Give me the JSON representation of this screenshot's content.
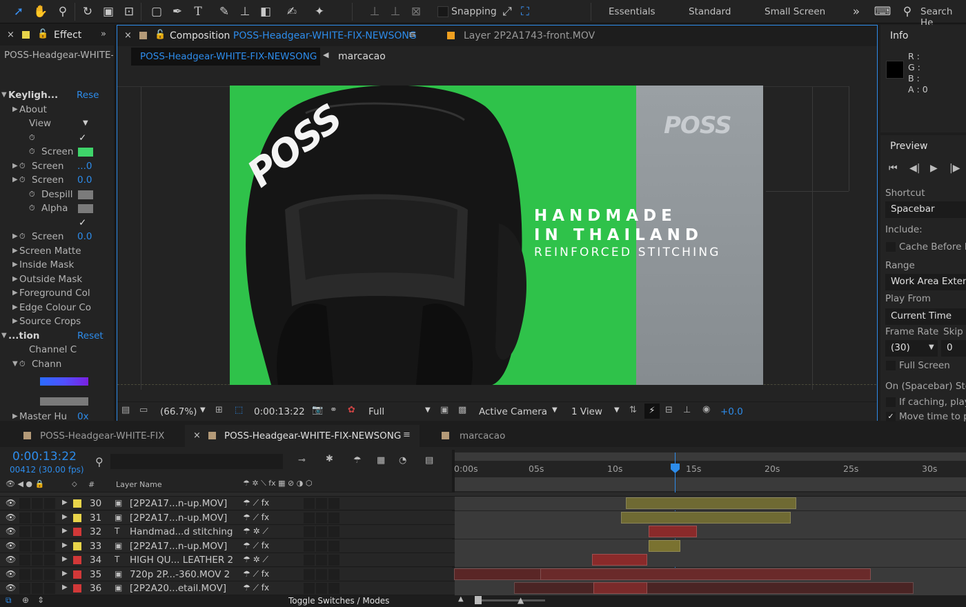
{
  "toolbar": {
    "snapping_label": "Snapping",
    "workspaces": [
      "Essentials",
      "Standard",
      "Small Screen"
    ],
    "search_placeholder": "Search He"
  },
  "effects_panel": {
    "tab_label": "Effect",
    "layer_name": "POSS-Headgear-WHITE-",
    "rows": [
      {
        "label": "Keyligh...",
        "value": "Rese"
      },
      {
        "label": "About"
      },
      {
        "label": "View"
      },
      {
        "label": "",
        "value": "✓"
      },
      {
        "label": "Screen",
        "swatch": "#3fd46a"
      },
      {
        "label": "Screen",
        "value": "...0"
      },
      {
        "label": "Screen",
        "value": "0.0"
      },
      {
        "label": "Despill",
        "swatch": "#7b7b7b"
      },
      {
        "label": "Alpha",
        "swatch": "#7b7b7b"
      },
      {
        "label": "",
        "value": "✓"
      },
      {
        "label": "Screen",
        "value": "0.0"
      },
      {
        "label": "Screen Matte"
      },
      {
        "label": "Inside Mask"
      },
      {
        "label": "Outside Mask"
      },
      {
        "label": "Foreground Col"
      },
      {
        "label": "Edge Colour Co"
      },
      {
        "label": "Source Crops"
      },
      {
        "label": "...tion",
        "value": "Reset"
      },
      {
        "label": "Channel C"
      },
      {
        "label": "Chann"
      },
      {
        "label": "Master Hu",
        "value": "0x"
      }
    ]
  },
  "comp_panel": {
    "tab_label_prefix": "Composition",
    "tab_comp_name": "POSS-Headgear-WHITE-FIX-NEWSONG",
    "tab_layer": "Layer 2P2A1743-front.MOV",
    "breadcrumb_comp": "POSS-Headgear-WHITE-FIX-NEWSONG",
    "breadcrumb_child": "marcacao",
    "video": {
      "headline1": "HANDMADE",
      "headline2": "IN THAILAND",
      "subline": "REINFORCED STITCHING",
      "logo_text": "POSS",
      "helmet_logo": "POSS",
      "green": "#2fc24a",
      "gray": "#8e9498"
    },
    "footer": {
      "zoom": "(66.7%)",
      "timecode": "0:00:13:22",
      "quality": "Full",
      "camera": "Active Camera",
      "views": "1 View",
      "exposure": "+0.0"
    }
  },
  "info_panel": {
    "title": "Info",
    "r": "R :",
    "g": "G :",
    "b": "B :",
    "a": "A : 0"
  },
  "preview_panel": {
    "title": "Preview",
    "shortcut_label": "Shortcut",
    "shortcut_value": "Spacebar",
    "include_label": "Include:",
    "cache_label": "Cache Before P",
    "range_label": "Range",
    "range_value": "Work Area Extend",
    "playfrom_label": "Play From",
    "playfrom_value": "Current Time",
    "framerate_label": "Frame Rate",
    "skip_label": "Skip",
    "framerate_value": "(30)",
    "skip_value": "0",
    "fullscreen_label": "Full Screen",
    "stop_label": "On (Spacebar) Stop:",
    "caching_label": "If caching, play",
    "movetime_label": "Move time to p"
  },
  "timeline": {
    "tabs": [
      "POSS-Headgear-WHITE-FIX",
      "POSS-Headgear-WHITE-FIX-NEWSONG",
      "marcacao"
    ],
    "timecode": "0:00:13:22",
    "frames": "00412 (30.00 fps)",
    "header_layer_name": "Layer Name",
    "header_hash": "#",
    "ruler": [
      "0:00s",
      "05s",
      "10s",
      "15s",
      "20s",
      "25s",
      "30s"
    ],
    "layers": [
      {
        "num": "30",
        "color": "#e8d44a",
        "name": "[2P2A17...n-up.MOV]",
        "type": "footage"
      },
      {
        "num": "31",
        "color": "#e8d44a",
        "name": "[2P2A17...n-up.MOV]",
        "type": "footage"
      },
      {
        "num": "32",
        "color": "#d13838",
        "name": "Handmad...d stitching",
        "type": "text"
      },
      {
        "num": "33",
        "color": "#e8d44a",
        "name": "[2P2A17...n-up.MOV]",
        "type": "footage"
      },
      {
        "num": "34",
        "color": "#d13838",
        "name": "HIGH QU... LEATHER 2",
        "type": "text"
      },
      {
        "num": "35",
        "color": "#d13838",
        "name": "720p 2P...-360.MOV 2",
        "type": "footage"
      },
      {
        "num": "36",
        "color": "#d13838",
        "name": "[2P2A20...etail.MOV]",
        "type": "footage"
      }
    ],
    "footer_toggle": "Toggle Switches / Modes"
  }
}
